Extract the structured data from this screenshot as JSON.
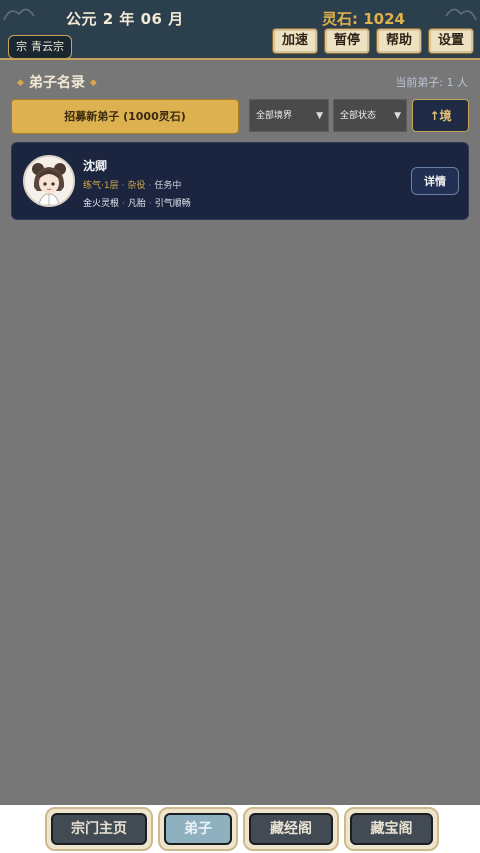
{
  "header": {
    "date": "公元 2 年 06 月",
    "spirit_stones": "灵石: 1024",
    "sect_badge_char": "宗",
    "sect_name": "青云宗",
    "buttons": {
      "speed": "加速",
      "pause": "暂停",
      "help": "帮助",
      "settings": "设置"
    }
  },
  "disciples": {
    "section_title": "弟子名录",
    "current_count": "当前弟子: 1 人",
    "recruit_label": "招募新弟子 (1000灵石)",
    "realm_filter": "全部境界",
    "status_filter": "全部状态",
    "sort_label": "↑境",
    "list": [
      {
        "name": "沈卿",
        "realm": "练气·1层",
        "role": "杂役",
        "status": "任务中",
        "root": "金火灵根",
        "physique": "凡胎",
        "trait": "引气顺畅",
        "detail_label": "详情"
      }
    ]
  },
  "nav": {
    "home": "宗门主页",
    "disciples": "弟子",
    "scriptures": "藏经阁",
    "treasury": "藏宝阁"
  },
  "colors": {
    "header_bg": "#2b3f4d",
    "accent_gold": "#ddb150",
    "card_bg": "#1b2540",
    "panel_bg": "#777777"
  }
}
